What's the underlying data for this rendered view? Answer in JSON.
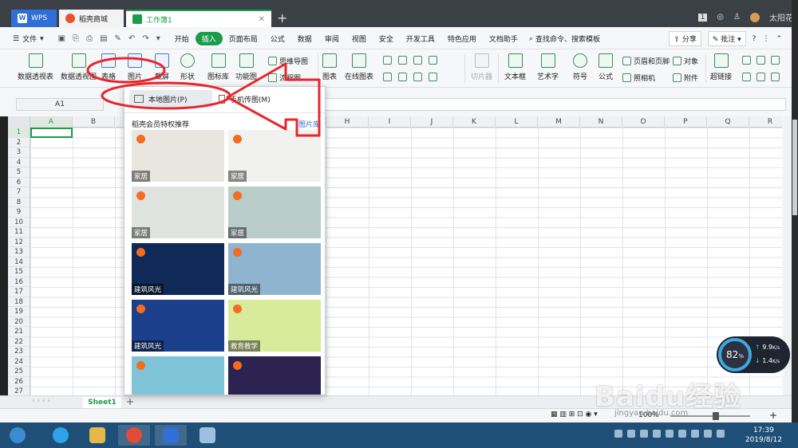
{
  "titlebar": {
    "tabs": [
      {
        "label": "WPS",
        "icon": "wps-logo-icon"
      },
      {
        "label": "稻壳商城",
        "icon": "docer-icon"
      },
      {
        "label": "工作簿1",
        "icon": "spreadsheet-icon"
      }
    ],
    "window_count": "1",
    "user": "太阳花"
  },
  "menubar": {
    "file_label": "文件",
    "tabs": [
      "开始",
      "插入",
      "页面布局",
      "公式",
      "数据",
      "审阅",
      "视图",
      "安全",
      "开发工具",
      "特色应用",
      "文档助手"
    ],
    "active_tab": "插入",
    "search_label": "查找命令、搜索模板",
    "share_label": "分享",
    "comment_label": "批注"
  },
  "ribbon": {
    "buttons": [
      "数据透视表",
      "数据透视图",
      "表格",
      "图片",
      "截屏",
      "形状",
      "图标库",
      "功能图",
      "图表",
      "在线图表",
      "切片器",
      "文本框",
      "艺术字",
      "符号",
      "公式",
      "超链接"
    ],
    "small": [
      "思维导图",
      "流程图",
      "页眉和页脚",
      "对象",
      "照相机",
      "附件"
    ]
  },
  "formula": {
    "namebox": "A1"
  },
  "grid": {
    "columns": [
      "A",
      "B",
      "C",
      "D",
      "E",
      "F",
      "G",
      "H",
      "I",
      "J",
      "K",
      "L",
      "M",
      "N",
      "O",
      "P",
      "Q",
      "R"
    ],
    "rows": [
      "1",
      "2",
      "3",
      "4",
      "5",
      "6",
      "7",
      "8",
      "9",
      "10",
      "11",
      "12",
      "13",
      "14",
      "15",
      "16",
      "17",
      "18",
      "19",
      "20",
      "21",
      "22",
      "23",
      "24",
      "25",
      "26",
      "27"
    ]
  },
  "sheets": {
    "active": "Sheet1"
  },
  "status": {
    "zoom": "100%"
  },
  "dropdown": {
    "local_picture": "本地图片(P)",
    "phone_picture": "手机传图(M)",
    "section_title": "稻壳会员特权推荐",
    "more": "图片库",
    "thumbs": [
      {
        "label": "家居",
        "color": "#e9e6df"
      },
      {
        "label": "家居",
        "color": "#f1f1ef"
      },
      {
        "label": "家居",
        "color": "#dfe3df"
      },
      {
        "label": "家居",
        "color": "#b8cdc8"
      },
      {
        "label": "建筑风光",
        "color": "#0f2a56"
      },
      {
        "label": "建筑风光",
        "color": "#8fb4cf"
      },
      {
        "label": "建筑风光",
        "color": "#1b3f8a"
      },
      {
        "label": "教育教学",
        "color": "#d7eb9a"
      },
      {
        "label": "",
        "color": "#7fc3d6"
      },
      {
        "label": "",
        "color": "#2c2350"
      }
    ]
  },
  "speed": {
    "percent": "82",
    "unit": "%",
    "up": "9.9",
    "down": "1.4",
    "rate_unit": "K/s"
  },
  "taskbar": {
    "time": "17:39",
    "date": "2019/8/12"
  },
  "watermark": {
    "text": "Baidu经验",
    "url": "jingyan.baidu.com"
  },
  "colors": {
    "accent": "#1b9c4b",
    "annotation": "#e8262b"
  }
}
